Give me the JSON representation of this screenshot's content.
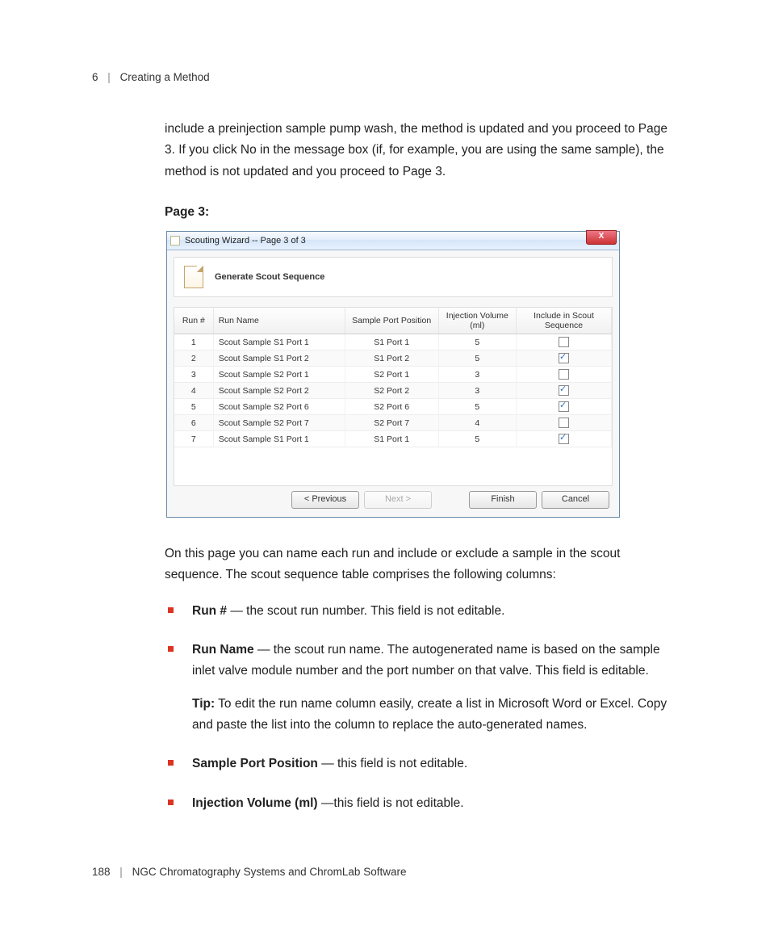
{
  "header": {
    "chapter_num": "6",
    "chapter_title": "Creating a Method"
  },
  "intro_paragraph": "include a preinjection sample pump wash, the method is updated and you proceed to Page 3. If you click No in the message box (if, for example, you are using the same sample), the method is not updated and you proceed to Page 3.",
  "section_heading": "Page 3:",
  "dialog": {
    "title": "Scouting Wizard -- Page 3 of 3",
    "generate_label": "Generate Scout Sequence",
    "columns": {
      "run_num": "Run #",
      "run_name": "Run Name",
      "sample_port": "Sample Port Position",
      "inj_vol": "Injection Volume (ml)",
      "include": "Include in Scout Sequence"
    },
    "rows": [
      {
        "num": "1",
        "name": "Scout Sample S1 Port 1",
        "port": "S1 Port 1",
        "vol": "5",
        "inc": false
      },
      {
        "num": "2",
        "name": "Scout Sample S1 Port 2",
        "port": "S1 Port 2",
        "vol": "5",
        "inc": true
      },
      {
        "num": "3",
        "name": "Scout Sample S2 Port 1",
        "port": "S2 Port 1",
        "vol": "3",
        "inc": false
      },
      {
        "num": "4",
        "name": "Scout Sample S2 Port 2",
        "port": "S2 Port 2",
        "vol": "3",
        "inc": true
      },
      {
        "num": "5",
        "name": "Scout Sample S2 Port 6",
        "port": "S2 Port 6",
        "vol": "5",
        "inc": true
      },
      {
        "num": "6",
        "name": "Scout Sample S2 Port 7",
        "port": "S2 Port 7",
        "vol": "4",
        "inc": false
      },
      {
        "num": "7",
        "name": "Scout Sample S1 Port 1",
        "port": "S1 Port 1",
        "vol": "5",
        "inc": true
      }
    ],
    "buttons": {
      "previous": "< Previous",
      "next": "Next >",
      "finish": "Finish",
      "cancel": "Cancel"
    },
    "close_glyph": "X"
  },
  "after_dialog_paragraph": "On this page you can name each run and include or exclude a sample in the scout sequence. The scout sequence table comprises the following columns:",
  "bullets": {
    "b1": {
      "label": "Run #",
      "text": " — the scout run number. This field is not editable."
    },
    "b2": {
      "label": "Run Name",
      "text": " — the scout run name. The autogenerated name is based on the sample inlet valve module number and the port number on that valve. This field is editable.",
      "tip_label": "Tip:",
      "tip_text": "   To edit the run name column easily, create a list in Microsoft Word or Excel. Copy and paste the list into the column to replace the auto-generated names."
    },
    "b3": {
      "label": "Sample Port Position",
      "text": " — this field is not editable."
    },
    "b4": {
      "label": "Injection Volume (ml)",
      "text": " —this field is not editable."
    }
  },
  "footer": {
    "page_num": "188",
    "book_title": "NGC Chromatography Systems and ChromLab Software"
  }
}
